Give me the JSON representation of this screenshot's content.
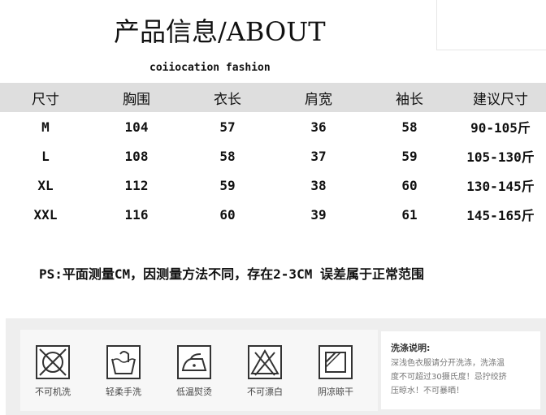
{
  "header": {
    "title": "产品信息/ABOUT",
    "brand": "coiiocation fashion"
  },
  "size_table": {
    "columns": [
      "尺寸",
      "胸围",
      "衣长",
      "肩宽",
      "袖长",
      "建议尺寸"
    ],
    "rows": [
      [
        "M",
        "104",
        "57",
        "36",
        "58",
        "90-105斤"
      ],
      [
        "L",
        "108",
        "58",
        "37",
        "59",
        "105-130斤"
      ],
      [
        "XL",
        "112",
        "59",
        "38",
        "60",
        "130-145斤"
      ],
      [
        "XXL",
        "116",
        "60",
        "39",
        "61",
        "145-165斤"
      ]
    ]
  },
  "note": "PS:平面测量CM，因测量方法不同，存在2-3CM 误差属于正常范围",
  "care": {
    "items": [
      {
        "icon": "no-machine-wash-icon",
        "label": "不可机洗"
      },
      {
        "icon": "gentle-hand-wash-icon",
        "label": "轻柔手洗"
      },
      {
        "icon": "low-temp-iron-icon",
        "label": "低温熨烫"
      },
      {
        "icon": "no-bleach-icon",
        "label": "不可漂白"
      },
      {
        "icon": "shade-dry-icon",
        "label": "阴凉晾干"
      }
    ],
    "instructions_title": "洗涤说明:",
    "instructions_lines": [
      "深浅色衣服请分开洗涤，洗涤温",
      "度不可超过30摄氏度！忌拧绞挤",
      "压晾水！不可暴晒！"
    ]
  }
}
